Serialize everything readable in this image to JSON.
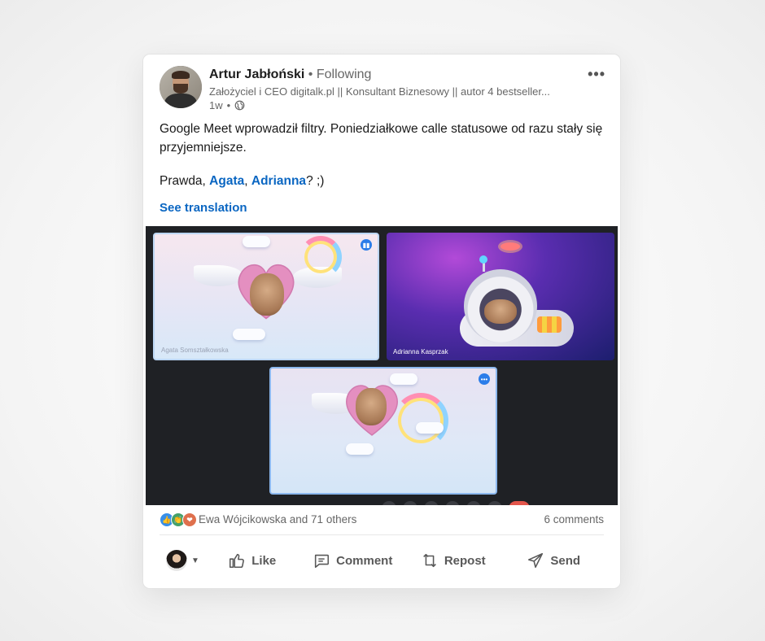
{
  "post": {
    "author_name": "Artur Jabłoński",
    "follow_status": "Following",
    "separator": " • ",
    "headline": "Założyciel i CEO digitalk.pl || Konsultant Biznesowy || autor 4 bestseller...",
    "time_ago": "1w",
    "visibility_icon": "globe-icon",
    "more_label": "•••",
    "text_line1": "Google Meet wprowadził filtry. Poniedziałkowe calle statusowe od razu stały się przyjemniejsze.",
    "text_prefix": "Prawda, ",
    "mention1": "Agata",
    "comma": ", ",
    "mention2": "Adrianna",
    "text_suffix": "? ;)",
    "see_translation": "See translation"
  },
  "media": {
    "tiles": [
      {
        "participant": "Agata Somształkowska",
        "filter": "heart-angel"
      },
      {
        "participant": "Adrianna Kasprzak",
        "filter": "astronaut"
      },
      {
        "participant": "",
        "filter": "heart-angel"
      }
    ]
  },
  "social": {
    "reactions": [
      "like-icon",
      "celebrate-icon",
      "love-icon"
    ],
    "reactors_text": "Ewa Wójcikowska and 71 others",
    "comments_text": "6 comments"
  },
  "actions": {
    "like": "Like",
    "comment": "Comment",
    "repost": "Repost",
    "send": "Send"
  },
  "colors": {
    "link": "#0a66c2",
    "text_secondary": "#666666",
    "action_text": "#595959"
  }
}
